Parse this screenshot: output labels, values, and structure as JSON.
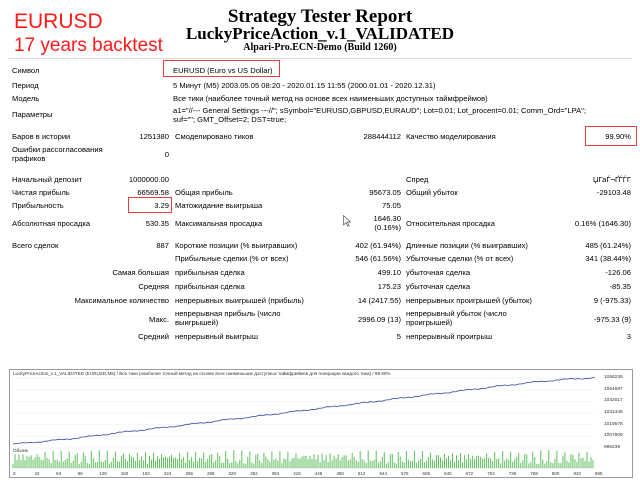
{
  "overlay": {
    "symbol": "EURUSD",
    "years": "17 years backtest"
  },
  "header": {
    "title": "Strategy Tester Report",
    "ea_name": "LuckyPriceAction_v.1_VALIDATED",
    "server": "Alpari-Pro.ECN-Demo (Build 1260)"
  },
  "info": {
    "symbol_label": "Символ",
    "symbol_value": "EURUSD (Euro vs US Dollar)",
    "period_label": "Период",
    "period_value": "5 Минут (M5) 2003.05.05 08:20 - 2020.01.15 11:55 (2000.01.01 - 2020.12.31)",
    "model_label": "Модель",
    "model_value": "Все тики (наиболее точный метод на основе всех наименьших доступных таймфреймов)",
    "params_label": "Параметры",
    "params_line1": "a1=\"//--- General Settings ---//\"; sSymbol=\"EURUSD,GBPUSD,EURAUD\"; Lot=0.01; Lot_procent=0.01; Comm_Ord=\"LPA\";",
    "params_line2": "suf=\"\"; GMT_Offset=2; DST=true;"
  },
  "stats": {
    "bars_label": "Баров в истории",
    "bars_value": "1251380",
    "ticks_label": "Смоделировано тиков",
    "ticks_value": "288444112",
    "quality_label": "Качество моделирования",
    "quality_value": "99.90%",
    "errors_label": "Ошибки рассогласования графиков",
    "errors_value": "0",
    "deposit_label": "Начальный депозит",
    "deposit_value": "1000000.00",
    "spread_label": "Спред",
    "spread_value": "ЏГаЃ¬ҐЃЃГ",
    "net_label": "Чистая прибыль",
    "net_value": "66569.58",
    "gross_profit_label": "Общая прибыль",
    "gross_profit_value": "95673.05",
    "gross_loss_label": "Общий убыток",
    "gross_loss_value": "-29103.48",
    "pf_label": "Прибыльность",
    "pf_value": "3.29",
    "expect_label": "Матожидание выигрыша",
    "expect_value": "75.05",
    "abs_dd_label": "Абсолютная просадка",
    "abs_dd_value": "530.35",
    "max_dd_label": "Максимальная просадка",
    "max_dd_value": "1646.30",
    "max_dd_pct": "(0.16%)",
    "rel_dd_label": "Относительная просадка",
    "rel_dd_value": "0.16% (1646.30)",
    "total_label": "Всего сделок",
    "total_value": "887",
    "short_label": "Короткие позиции (% выигравших)",
    "short_value": "402 (61.94%)",
    "long_label": "Длинные позиции (% выигравших)",
    "long_value": "485 (61.24%)",
    "profit_trades_label": "Прибыльные сделки (% от всех)",
    "profit_trades_value": "546 (61.56%)",
    "loss_trades_label": "Убыточные сделки (% от всех)",
    "loss_trades_value": "341 (38.44%)",
    "largest_label": "Самая большая",
    "largest_profit_label": "прибыльная сделка",
    "largest_profit_value": "499.10",
    "largest_loss_label": "убыточная сделка",
    "largest_loss_value": "-126.06",
    "avg_label": "Средняя",
    "avg_profit_label": "прибыльная сделка",
    "avg_profit_value": "175.23",
    "avg_loss_label": "убыточная сделка",
    "avg_loss_value": "-85.35",
    "maxcount_label": "Максимальное количество",
    "maxcount_wins_label": "непрерывных выигрышей (прибыль)",
    "maxcount_wins_value": "14 (2417.55)",
    "maxcount_losses_label": "непрерывных проигрышей (убыток)",
    "maxcount_losses_value": "9 (-975.33)",
    "max_label": "Макс.",
    "max_profit_label1": "непрерывная прибыль (число",
    "max_profit_label2": "выигрышей)",
    "max_profit_value": "2996.09 (13)",
    "max_loss_label1": "непрерывный убыток (число",
    "max_loss_label2": "проигрышей)",
    "max_loss_value": "-975.33 (9)",
    "avg2_label": "Средний",
    "avg2_wins_label": "непрерывный выигрыш",
    "avg2_wins_value": "5",
    "avg2_losses_label": "непрерывный проигрыш",
    "avg2_losses_value": "3"
  },
  "chart_data": {
    "type": "line",
    "title": "LuckyPriceAction_v.1_VALIDATED (EURUSD,M5) / Все тики (наиболее точный метод на основе всех наименьших доступных таймфреймов для генерации каждого тика) / 99.90%",
    "volume_label": "Объем",
    "y_ticks": [
      "1066236",
      "1054587",
      "1042017",
      "1031446",
      "1019578",
      "1007809",
      "996239"
    ],
    "x_ticks": [
      "0",
      "32",
      "64",
      "96",
      "128",
      "160",
      "192",
      "224",
      "256",
      "288",
      "320",
      "352",
      "384",
      "416",
      "448",
      "480",
      "512",
      "544",
      "576",
      "608",
      "640",
      "672",
      "704",
      "736",
      "768",
      "800",
      "832",
      "865"
    ],
    "ylim": [
      996239,
      1066236
    ],
    "xlim": [
      0,
      887
    ],
    "x": [
      0,
      40,
      80,
      120,
      160,
      200,
      240,
      280,
      320,
      360,
      400,
      440,
      480,
      520,
      560,
      600,
      640,
      680,
      720,
      760,
      800,
      840,
      887
    ],
    "y": [
      1000000,
      1002500,
      1005000,
      1008000,
      1011500,
      1014500,
      1017500,
      1020800,
      1024000,
      1027000,
      1030300,
      1033500,
      1037000,
      1040200,
      1043500,
      1046800,
      1050000,
      1053200,
      1056500,
      1059500,
      1062500,
      1064800,
      1066569
    ],
    "line_color": "#3248a8",
    "volume_color": "#5fbf5f"
  }
}
